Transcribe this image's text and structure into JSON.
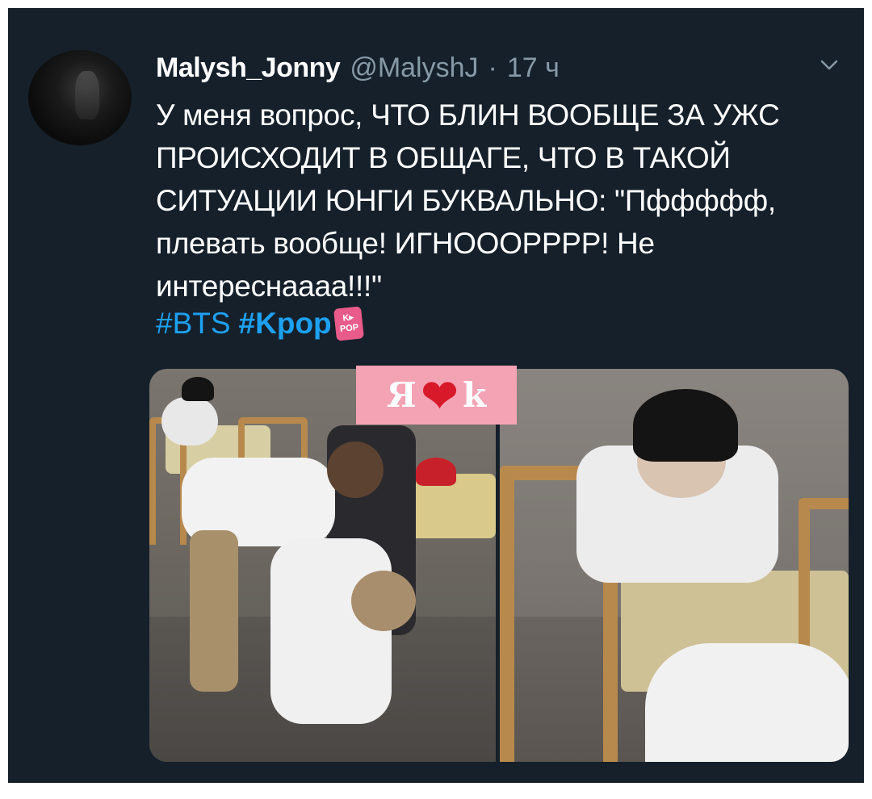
{
  "tweet": {
    "display_name": "Malysh_Jonny",
    "handle": "@MalyshJ",
    "separator": "·",
    "time": "17 ч",
    "text": "У меня вопрос, ЧТО БЛИН ВООБЩЕ ЗА УЖС ПРОИСХОДИТ В ОБЩАГЕ, ЧТО В ТАКОЙ СИТУАЦИИ ЮНГИ БУКВАЛЬНО: \"Пффффф, плевать вообще! ИГНОООРРРР! Не интереснаааа!!!\"",
    "hashtags": [
      "#BTS",
      "#Kpop"
    ],
    "kpop_emoji": [
      "K▸",
      "POP"
    ]
  },
  "watermark": {
    "left": "Я",
    "heart": "❤",
    "right": "k"
  },
  "colors": {
    "background": "#15202b",
    "text": "#ffffff",
    "muted": "#8899a6",
    "link": "#1da1f2",
    "watermark_bg": "#f4a3b5"
  }
}
